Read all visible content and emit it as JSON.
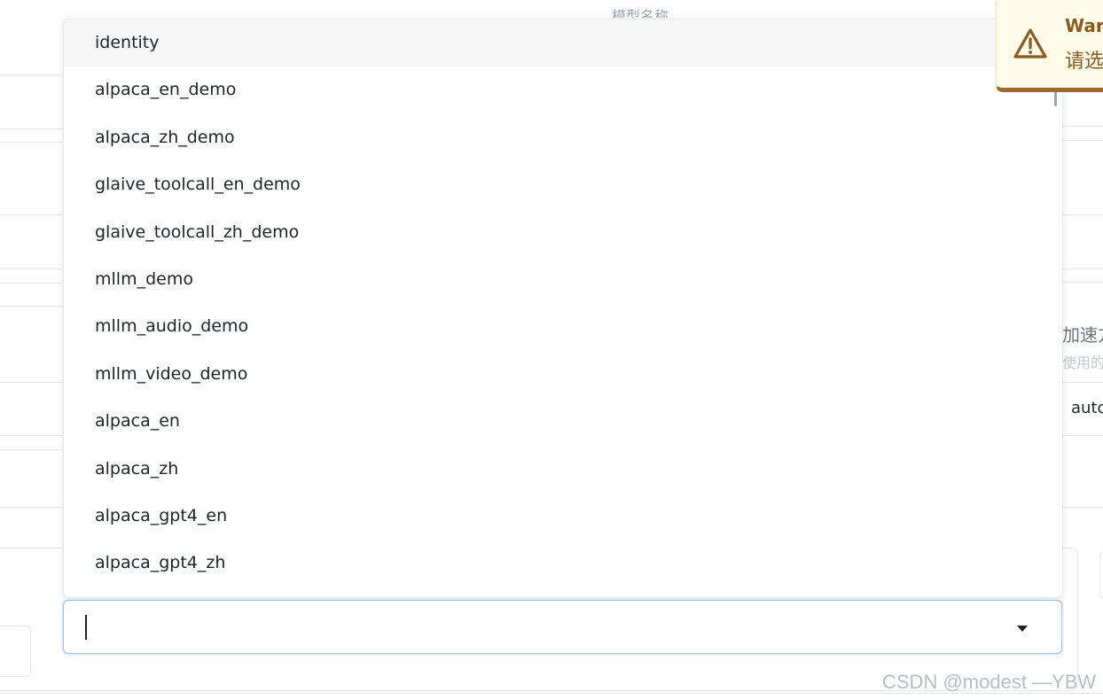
{
  "background": {
    "top_fragment": "模型名称",
    "right_title": "加速方",
    "right_subtitle": "使用的加",
    "right_value": "auto"
  },
  "dropdown": {
    "items": [
      {
        "label": "identity",
        "active": true
      },
      {
        "label": "alpaca_en_demo"
      },
      {
        "label": "alpaca_zh_demo"
      },
      {
        "label": "glaive_toolcall_en_demo"
      },
      {
        "label": "glaive_toolcall_zh_demo"
      },
      {
        "label": "mllm_demo"
      },
      {
        "label": "mllm_audio_demo"
      },
      {
        "label": "mllm_video_demo"
      },
      {
        "label": "alpaca_en"
      },
      {
        "label": "alpaca_zh"
      },
      {
        "label": "alpaca_gpt4_en"
      },
      {
        "label": "alpaca_gpt4_zh"
      }
    ]
  },
  "combo": {
    "value": "",
    "icon": "chevron-down-icon"
  },
  "toast": {
    "title": "Warning",
    "message": "请选择数据集",
    "icon": "warning-icon",
    "accent_color": "#9a6b2c"
  },
  "watermark": "CSDN @modest —YBW"
}
